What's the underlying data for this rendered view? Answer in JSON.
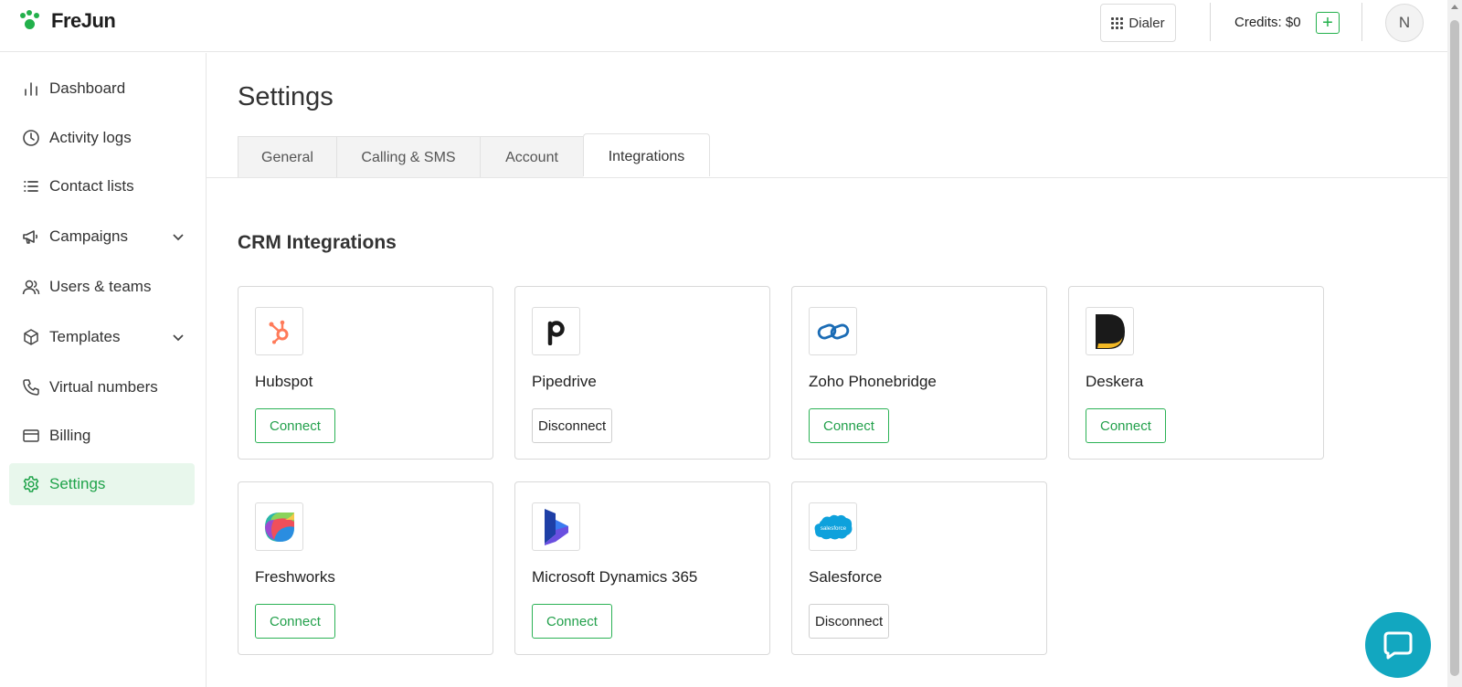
{
  "brand": {
    "name": "FreJun",
    "accent_color": "#22b04b"
  },
  "header": {
    "dialer_label": "Dialer",
    "dialer_icon": "dialpad-icon",
    "credits_text": "Credits: $0",
    "add_credits_icon": "plus-icon",
    "avatar_initial": "N"
  },
  "sidebar": {
    "items": [
      {
        "label": "Dashboard",
        "icon": "bar-chart-icon"
      },
      {
        "label": "Activity logs",
        "icon": "clock-icon"
      },
      {
        "label": "Contact lists",
        "icon": "list-icon"
      },
      {
        "label": "Campaigns",
        "icon": "megaphone-icon",
        "expandable": true
      },
      {
        "label": "Users & teams",
        "icon": "users-icon"
      },
      {
        "label": "Templates",
        "icon": "cube-icon",
        "expandable": true
      },
      {
        "label": "Virtual numbers",
        "icon": "phone-icon"
      },
      {
        "label": "Billing",
        "icon": "credit-card-icon"
      },
      {
        "label": "Settings",
        "icon": "gear-icon",
        "active": true
      }
    ]
  },
  "main": {
    "title": "Settings",
    "tabs": [
      {
        "label": "General"
      },
      {
        "label": "Calling & SMS"
      },
      {
        "label": "Account"
      },
      {
        "label": "Integrations",
        "active": true
      }
    ],
    "section_title": "CRM Integrations",
    "integrations": [
      {
        "name": "Hubspot",
        "action": "Connect",
        "logo": "hubspot-logo"
      },
      {
        "name": "Pipedrive",
        "action": "Disconnect",
        "logo": "pipedrive-logo"
      },
      {
        "name": "Zoho Phonebridge",
        "action": "Connect",
        "logo": "zoho-logo"
      },
      {
        "name": "Deskera",
        "action": "Connect",
        "logo": "deskera-logo"
      },
      {
        "name": "Freshworks",
        "action": "Connect",
        "logo": "freshworks-logo"
      },
      {
        "name": "Microsoft Dynamics 365",
        "action": "Connect",
        "logo": "dynamics-logo"
      },
      {
        "name": "Salesforce",
        "action": "Disconnect",
        "logo": "salesforce-logo"
      }
    ],
    "salesforce_logo_text": "salesforce"
  },
  "chat": {
    "icon": "chat-bubble-icon"
  }
}
